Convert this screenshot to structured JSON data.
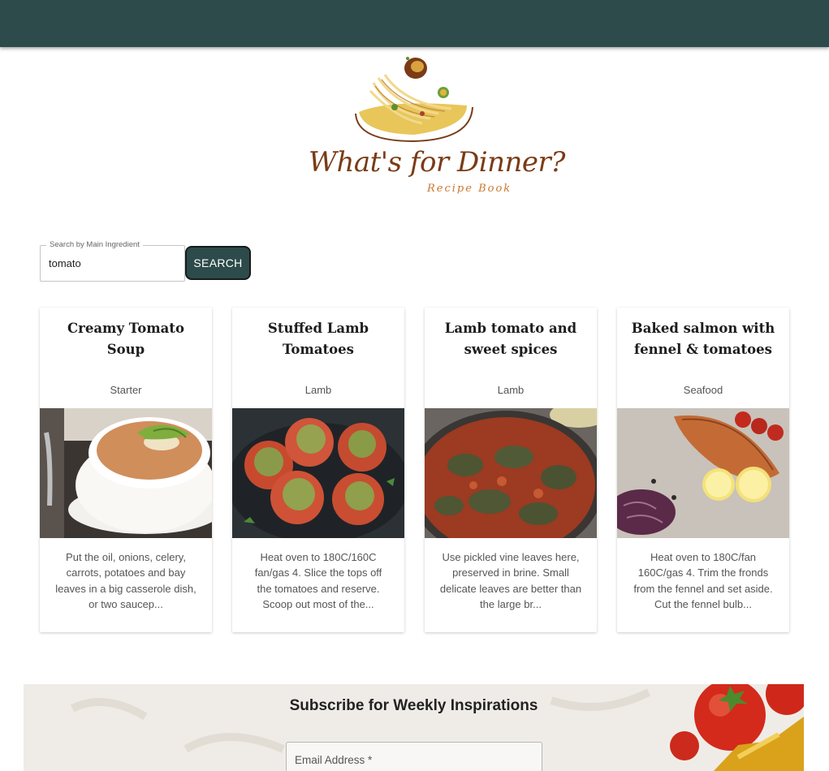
{
  "brand": {
    "title": "What's for Dinner?",
    "subtitle": "Recipe Book"
  },
  "search": {
    "legend": "Search by Main Ingredient",
    "value": "tomato",
    "button_label": "SEARCH"
  },
  "recipes": [
    {
      "title": "Creamy Tomato Soup",
      "category": "Starter",
      "description": "Put the oil, onions, celery, carrots, potatoes and bay leaves in a big casserole dish, or two saucep..."
    },
    {
      "title": "Stuffed Lamb Tomatoes",
      "category": "Lamb",
      "description": "Heat oven to 180C/160C fan/gas 4. Slice the tops off the tomatoes and reserve. Scoop out most of the..."
    },
    {
      "title": "Lamb tomato and sweet spices",
      "category": "Lamb",
      "description": "Use pickled vine leaves here, preserved in brine. Small delicate leaves are better than the large br..."
    },
    {
      "title": "Baked salmon with fennel & tomatoes",
      "category": "Seafood",
      "description": "Heat oven to 180C/fan 160C/gas 4. Trim the fronds from the fennel and set aside. Cut the fennel bulb..."
    }
  ],
  "subscribe": {
    "title": "Subscribe for Weekly Inspirations",
    "email_label": "Email Address *"
  },
  "colors": {
    "header": "#2c4b4a",
    "button": "#2c4b4a",
    "brand_text": "#7a3b16",
    "brand_sub": "#c9782f"
  },
  "icons": [
    "pasta-bowl-logo-icon"
  ]
}
